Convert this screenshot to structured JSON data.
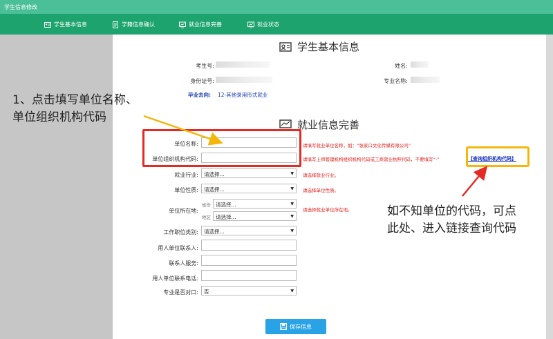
{
  "window": {
    "title": "学生信息修改"
  },
  "nav": {
    "items": [
      {
        "label": "学生基本信息",
        "icon": "id-card-icon"
      },
      {
        "label": "学籍信息确认",
        "icon": "document-icon"
      },
      {
        "label": "就业信息完善",
        "icon": "monitor-chart-icon"
      },
      {
        "label": "就业状态",
        "icon": "monitor-chart-icon"
      }
    ]
  },
  "basic_info": {
    "title": "学生基本信息",
    "exam_no_label": "考生号:",
    "name_label": "姓名:",
    "id_no_label": "身份证号:",
    "major_label": "专业名称:",
    "destination_label": "毕业去向:",
    "destination_value": "12-其他录用形式就业"
  },
  "employment": {
    "title": "就业信息完善",
    "fields": {
      "unit_name": "单位名称:",
      "org_code": "单位组织机构代码:",
      "industry": "就业行业:",
      "unit_nature": "单位性质:",
      "location": "单位所在地:",
      "job_category": "工作职位类别:",
      "contact_person": "用人单位联系人:",
      "contact_service": "联系人服务:",
      "contact_phone": "用人单位联系电话:",
      "major_match": "专业是否对口:"
    },
    "select_placeholder": "请选择...",
    "province_label": "省份",
    "district_label": "地区",
    "major_match_value": "否",
    "hints": {
      "unit_name": "请填写就业单位名称，如：“张家口文化传媒有限公司”",
      "org_code": "请填写上师管理机构组织机构代码或工商营业执照代码，不要填写“-”",
      "industry": "请选择就业行业。",
      "unit_nature": "请选择单位性质。",
      "location": "请选择就业单位所在地。"
    },
    "lookup_link": "【查询组织机构代码】",
    "save_button": "保存信息"
  },
  "annotations": {
    "left_line1": "1、点击填写单位名称、",
    "left_line2": "单位组织机构代码",
    "right_line1": "如不知单位的代码，可点",
    "right_line2": "此处、进入链接查询代码"
  },
  "colors": {
    "nav_bg": "#1da36d",
    "titlebar_bg": "#4bbf97",
    "highlight_red": "#e42a24",
    "highlight_orange": "#f5b60a",
    "hint_red": "#e0201b",
    "save_blue": "#2aa3e6"
  }
}
